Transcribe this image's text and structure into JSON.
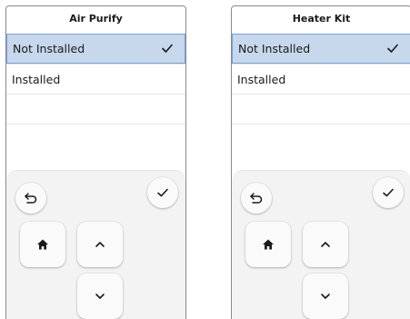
{
  "panels": [
    {
      "title": "Air Purify",
      "options": [
        {
          "label": "Not Installed",
          "selected": true
        },
        {
          "label": "Installed",
          "selected": false
        },
        {
          "label": "",
          "selected": false
        },
        {
          "label": "",
          "selected": false
        }
      ]
    },
    {
      "title": "Heater Kit",
      "options": [
        {
          "label": "Not Installed",
          "selected": true
        },
        {
          "label": "Installed",
          "selected": false
        },
        {
          "label": "",
          "selected": false
        },
        {
          "label": "",
          "selected": false
        }
      ]
    }
  ],
  "icons": {
    "check": "check-icon",
    "back": "back-arrow-icon",
    "confirm": "checkmark-icon",
    "home": "home-icon",
    "up": "chevron-up-icon",
    "down": "chevron-down-icon"
  },
  "colors": {
    "selected_background": "#c7d7ec",
    "selected_border": "#7b9fcf"
  }
}
